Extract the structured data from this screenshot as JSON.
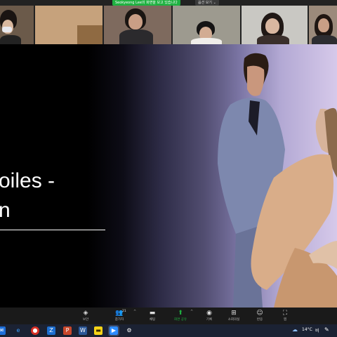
{
  "meeting": {
    "share_banner": "Seokyeong Lee의 화면을 보고 있습니다",
    "view_options": "옵션 보기 ⌄"
  },
  "slide": {
    "title": "oiles -\nn"
  },
  "toolbar": {
    "security": {
      "label": "보안",
      "icon": "shield-icon"
    },
    "participants": {
      "label": "참가자",
      "count": "21",
      "icon": "people-icon"
    },
    "chat": {
      "label": "채팅",
      "icon": "chat-icon"
    },
    "share_screen": {
      "label": "화면 공유",
      "icon": "share-screen-icon",
      "color": "#1fb141"
    },
    "record": {
      "label": "기록",
      "icon": "record-icon"
    },
    "breakout": {
      "label": "소회의실",
      "icon": "breakout-rooms-icon"
    },
    "reactions": {
      "label": "반응",
      "icon": "reaction-icon"
    },
    "apps": {
      "label": "앱",
      "icon": "apps-icon"
    }
  },
  "taskbar": {
    "weather": "14°C",
    "language": "비",
    "apps": [
      "mail-icon",
      "edge-icon",
      "chrome-icon",
      "zoom-app-icon",
      "powerpoint-icon",
      "word-icon",
      "kakaotalk-icon",
      "zoom-active-icon",
      "settings-icon"
    ]
  },
  "colors": {
    "accent": "#1fb141",
    "toolbar_bg": "#1a1a1a",
    "taskbar_bg": "#1b2233"
  }
}
